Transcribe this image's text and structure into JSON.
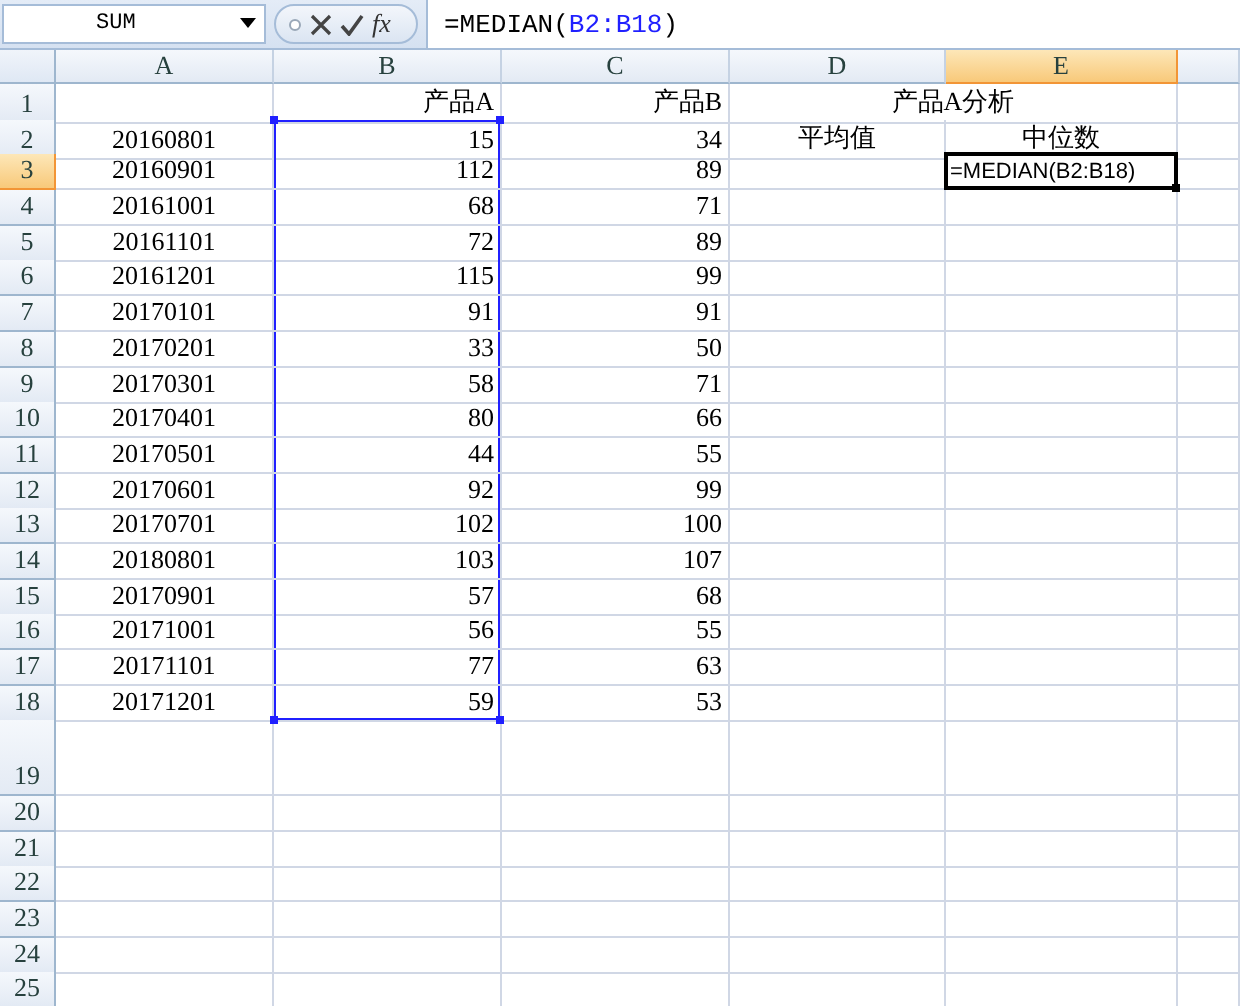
{
  "name_box": {
    "value": "SUM"
  },
  "formula_bar": {
    "function_button": "fx",
    "formula": [
      {
        "text": "=MEDIAN(",
        "kind": "plain"
      },
      {
        "text": "B2:B18",
        "kind": "reference"
      },
      {
        "text": ")",
        "kind": "plain"
      }
    ]
  },
  "columns": [
    {
      "label": "A",
      "selected": false
    },
    {
      "label": "B",
      "selected": false
    },
    {
      "label": "C",
      "selected": false
    },
    {
      "label": "D",
      "selected": false
    },
    {
      "label": "E",
      "selected": true
    }
  ],
  "rows": [
    {
      "header": "1",
      "selected": false,
      "in_reference": false,
      "cells": {
        "B": "产品A",
        "C": "产品B",
        "DE": "产品A分析"
      }
    },
    {
      "header": "2",
      "selected": false,
      "in_reference": true,
      "cells": {
        "A": "20160801",
        "B": "15",
        "C": "34",
        "D": "平均值",
        "E": "中位数"
      }
    },
    {
      "header": "3",
      "selected": true,
      "in_reference": true,
      "cells": {
        "A": "20160901",
        "B": "112",
        "C": "89"
      },
      "editor": "=MEDIAN(B2:B18)"
    },
    {
      "header": "4",
      "selected": false,
      "in_reference": true,
      "cells": {
        "A": "20161001",
        "B": "68",
        "C": "71"
      }
    },
    {
      "header": "5",
      "selected": false,
      "in_reference": true,
      "cells": {
        "A": "20161101",
        "B": "72",
        "C": "89"
      }
    },
    {
      "header": "6",
      "selected": false,
      "in_reference": true,
      "cells": {
        "A": "20161201",
        "B": "115",
        "C": "99"
      }
    },
    {
      "header": "7",
      "selected": false,
      "in_reference": true,
      "cells": {
        "A": "20170101",
        "B": "91",
        "C": "91"
      }
    },
    {
      "header": "8",
      "selected": false,
      "in_reference": true,
      "cells": {
        "A": "20170201",
        "B": "33",
        "C": "50"
      }
    },
    {
      "header": "9",
      "selected": false,
      "in_reference": true,
      "cells": {
        "A": "20170301",
        "B": "58",
        "C": "71"
      }
    },
    {
      "header": "10",
      "selected": false,
      "in_reference": true,
      "cells": {
        "A": "20170401",
        "B": "80",
        "C": "66"
      }
    },
    {
      "header": "11",
      "selected": false,
      "in_reference": true,
      "cells": {
        "A": "20170501",
        "B": "44",
        "C": "55"
      }
    },
    {
      "header": "12",
      "selected": false,
      "in_reference": true,
      "cells": {
        "A": "20170601",
        "B": "92",
        "C": "99"
      }
    },
    {
      "header": "13",
      "selected": false,
      "in_reference": true,
      "cells": {
        "A": "20170701",
        "B": "102",
        "C": "100"
      }
    },
    {
      "header": "14",
      "selected": false,
      "in_reference": true,
      "cells": {
        "A": "20180801",
        "B": "103",
        "C": "107"
      }
    },
    {
      "header": "15",
      "selected": false,
      "in_reference": true,
      "cells": {
        "A": "20170901",
        "B": "57",
        "C": "68"
      }
    },
    {
      "header": "16",
      "selected": false,
      "in_reference": true,
      "cells": {
        "A": "20171001",
        "B": "56",
        "C": "55"
      }
    },
    {
      "header": "17",
      "selected": false,
      "in_reference": true,
      "cells": {
        "A": "20171101",
        "B": "77",
        "C": "63"
      }
    },
    {
      "header": "18",
      "selected": false,
      "in_reference": true,
      "cells": {
        "A": "20171201",
        "B": "59",
        "C": "53"
      }
    },
    {
      "header": "19",
      "selected": false,
      "in_reference": false,
      "tall": true
    },
    {
      "header": "20",
      "selected": false,
      "in_reference": false
    },
    {
      "header": "21",
      "selected": false,
      "in_reference": false
    },
    {
      "header": "22",
      "selected": false,
      "in_reference": false
    },
    {
      "header": "23",
      "selected": false,
      "in_reference": false
    },
    {
      "header": "24",
      "selected": false,
      "in_reference": false
    },
    {
      "header": "25",
      "selected": false,
      "in_reference": false
    }
  ]
}
